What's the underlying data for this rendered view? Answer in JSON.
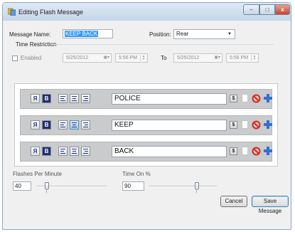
{
  "window": {
    "title": "Editing Flash Message",
    "minimize_label": "–",
    "maximize_label": "□",
    "close_label": "x"
  },
  "message_name": {
    "label": "Message Name:",
    "value": "KEEP BACK"
  },
  "position": {
    "label": "Position:",
    "selected": "Rear"
  },
  "time_restriction": {
    "group_label": "Time Restriction",
    "enabled_label": "Enabled",
    "from_date": "5/25/2012",
    "from_time": "5:56 PM",
    "to_label": "To",
    "to_date": "5/25/2012",
    "to_time": "5:56 PM"
  },
  "rows": [
    {
      "text": "POLICE"
    },
    {
      "text": "KEEP"
    },
    {
      "text": "BACK"
    }
  ],
  "row_buttons": {
    "reverse": "Я",
    "bold": "B",
    "dollar": "$"
  },
  "flashes_per_minute": {
    "label": "Flashes Per Minute",
    "value": "40"
  },
  "time_on": {
    "label": "Time On %",
    "value": "90"
  },
  "buttons": {
    "cancel": "Cancel",
    "save": "Save Message"
  },
  "colors": {
    "selection": "#3399ff",
    "delete": "#e0241b",
    "add": "#2f6fd6"
  }
}
